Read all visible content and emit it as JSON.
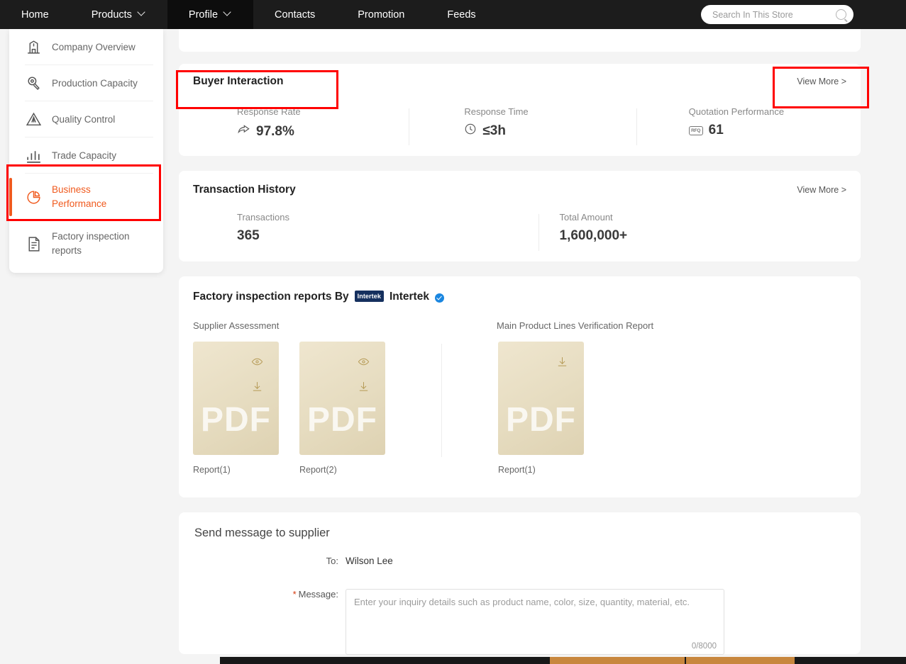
{
  "nav": {
    "items": [
      {
        "label": "Home",
        "caret": false,
        "active": false
      },
      {
        "label": "Products",
        "caret": true,
        "active": false
      },
      {
        "label": "Profile",
        "caret": true,
        "active": true
      },
      {
        "label": "Contacts",
        "caret": false,
        "active": false
      },
      {
        "label": "Promotion",
        "caret": false,
        "active": false
      },
      {
        "label": "Feeds",
        "caret": false,
        "active": false
      }
    ]
  },
  "search": {
    "placeholder": "Search In This Store",
    "value": "",
    "icon": "search-icon"
  },
  "sidebar": {
    "items": [
      {
        "label": "Company Overview",
        "icon": "factory-icon",
        "active": false
      },
      {
        "label": "Production Capacity",
        "icon": "wrench-gear-icon",
        "active": false
      },
      {
        "label": "Quality Control",
        "icon": "triangle-warning-icon",
        "active": false
      },
      {
        "label": "Trade Capacity",
        "icon": "bar-chart-icon",
        "active": false
      },
      {
        "label": "Business Performance",
        "icon": "pie-chart-icon",
        "active": true
      },
      {
        "label": "Factory inspection reports",
        "icon": "document-icon",
        "active": false
      }
    ]
  },
  "buyer_interaction": {
    "title": "Buyer Interaction",
    "view_more": "View More >",
    "metrics": [
      {
        "label": "Response Rate",
        "value": "97.8%",
        "icon": "share-arrow-icon"
      },
      {
        "label": "Response Time",
        "value": "≤3h",
        "icon": "clock-icon"
      },
      {
        "label": "Quotation Performance",
        "value": "61",
        "icon": "rfq-icon"
      }
    ]
  },
  "transaction_history": {
    "title": "Transaction History",
    "view_more": "View More >",
    "metrics": [
      {
        "label": "Transactions",
        "value": "365"
      },
      {
        "label": "Total Amount",
        "value": "1,600,000+"
      }
    ]
  },
  "factory_inspection": {
    "title_prefix": "Factory inspection reports By",
    "badge_text": "Intertek",
    "brand": "Intertek",
    "verified_icon": "verified-check-icon",
    "groups": [
      {
        "label": "Supplier Assessment",
        "docs": [
          {
            "caption": "Report(1)",
            "type": "PDF",
            "actions": [
              "eye-icon",
              "download-icon"
            ]
          },
          {
            "caption": "Report(2)",
            "type": "PDF",
            "actions": [
              "eye-icon",
              "download-icon"
            ]
          }
        ]
      },
      {
        "label": "Main Product Lines Verification Report",
        "docs": [
          {
            "caption": "Report(1)",
            "type": "PDF",
            "actions": [
              "download-icon"
            ]
          }
        ]
      }
    ]
  },
  "send_message": {
    "title": "Send message to supplier",
    "to_label": "To:",
    "to_value": "Wilson Lee",
    "message_label": "Message:",
    "required_mark": "*",
    "message_placeholder": "Enter your inquiry details such as product name, color, size, quantity, material, etc.",
    "message_value": "",
    "counter": "0/8000"
  },
  "colors": {
    "accent_orange": "#f05a1e",
    "nav_background": "#1c1c1c",
    "page_background": "#f4f4f4",
    "annotation_red": "#ff0000",
    "intertek_navy": "#15305e",
    "verified_blue": "#1a86e0"
  }
}
